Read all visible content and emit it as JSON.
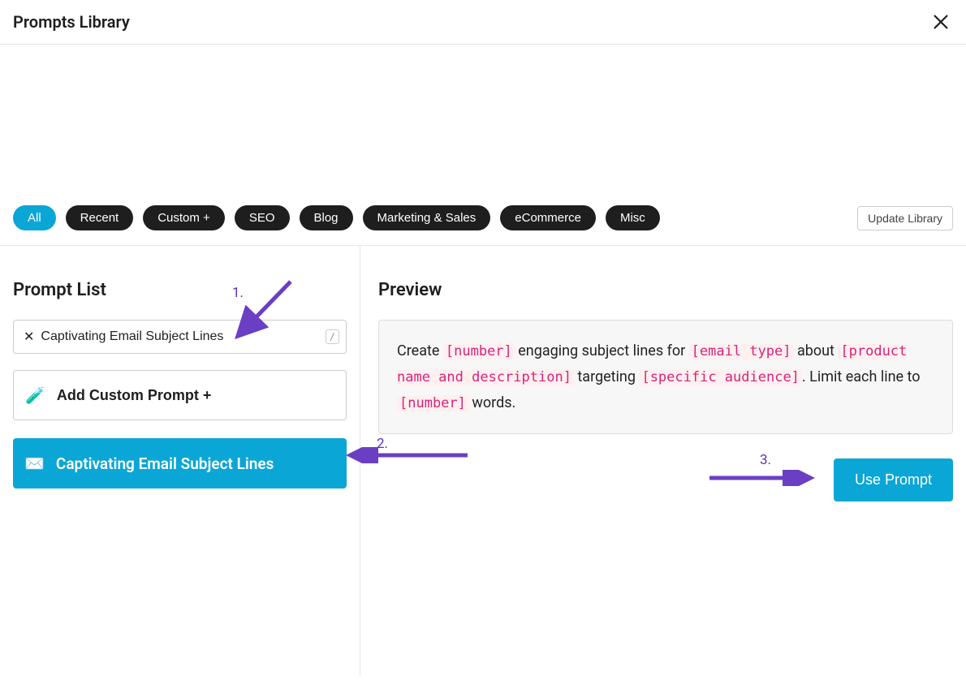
{
  "header": {
    "title": "Prompts Library"
  },
  "filters": {
    "tabs": [
      "All",
      "Recent",
      "Custom +",
      "SEO",
      "Blog",
      "Marketing & Sales",
      "eCommerce",
      "Misc"
    ],
    "active_index": 0,
    "update_label": "Update Library"
  },
  "left": {
    "title": "Prompt List",
    "search": {
      "value": "Captivating Email Subject Lines",
      "kbd": "/"
    },
    "add_custom": {
      "label": "Add Custom Prompt +",
      "icon": "🧪"
    },
    "selected": {
      "label": "Captivating Email Subject Lines",
      "icon": "✉️"
    }
  },
  "right": {
    "title": "Preview",
    "preview_parts": [
      {
        "t": "text",
        "v": "Create "
      },
      {
        "t": "ph",
        "v": "[number]"
      },
      {
        "t": "text",
        "v": " engaging subject lines for "
      },
      {
        "t": "ph",
        "v": "[email type]"
      },
      {
        "t": "text",
        "v": " about "
      },
      {
        "t": "ph",
        "v": "[product name and description]"
      },
      {
        "t": "text",
        "v": " targeting "
      },
      {
        "t": "ph",
        "v": "[specific audience]"
      },
      {
        "t": "text",
        "v": ". Limit each line to "
      },
      {
        "t": "ph",
        "v": "[number]"
      },
      {
        "t": "text",
        "v": " words."
      }
    ],
    "use_label": "Use Prompt"
  },
  "annotations": {
    "a1": "1.",
    "a2": "2.",
    "a3": "3."
  },
  "colors": {
    "accent": "#0aa6d6",
    "annotation": "#6a3fc4"
  }
}
